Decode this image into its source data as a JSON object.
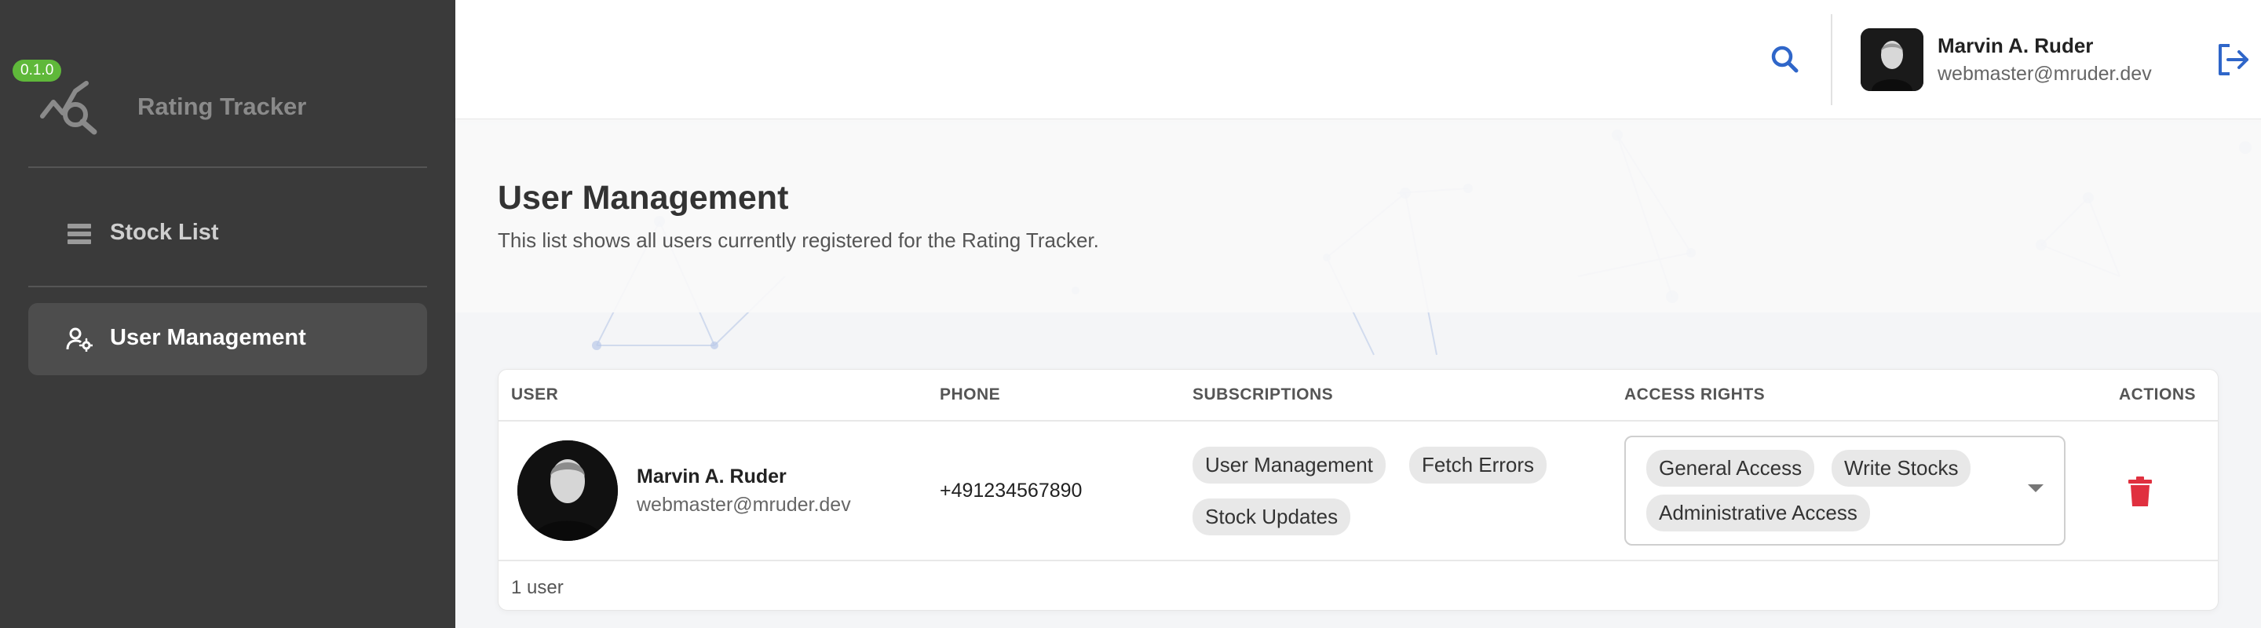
{
  "app": {
    "version": "0.1.0",
    "name": "Rating Tracker"
  },
  "sidebar": {
    "items": [
      {
        "label": "Stock List",
        "icon": "list-icon",
        "active": false
      },
      {
        "label": "User Management",
        "icon": "user-gear-icon",
        "active": true
      }
    ]
  },
  "header": {
    "user": {
      "name": "Marvin A. Ruder",
      "email": "webmaster@mruder.dev"
    },
    "icons": [
      "search-icon",
      "logout-icon"
    ]
  },
  "page": {
    "title": "User Management",
    "subtitle": "This list shows all users currently registered for the Rating Tracker."
  },
  "table": {
    "columns": [
      "USER",
      "PHONE",
      "SUBSCRIPTIONS",
      "ACCESS RIGHTS",
      "ACTIONS"
    ],
    "rows": [
      {
        "name": "Marvin A. Ruder",
        "email": "webmaster@mruder.dev",
        "phone": "+491234567890",
        "subscriptions": [
          "User Management",
          "Fetch Errors",
          "Stock Updates"
        ],
        "access_rights": [
          "General Access",
          "Write Stocks",
          "Administrative Access"
        ]
      }
    ],
    "footer": "1 user"
  },
  "colors": {
    "sidebar_bg": "#3a3a3a",
    "accent_blue": "#2f66c9",
    "badge_green": "#5fb83a",
    "delete_red": "#e0303f"
  }
}
